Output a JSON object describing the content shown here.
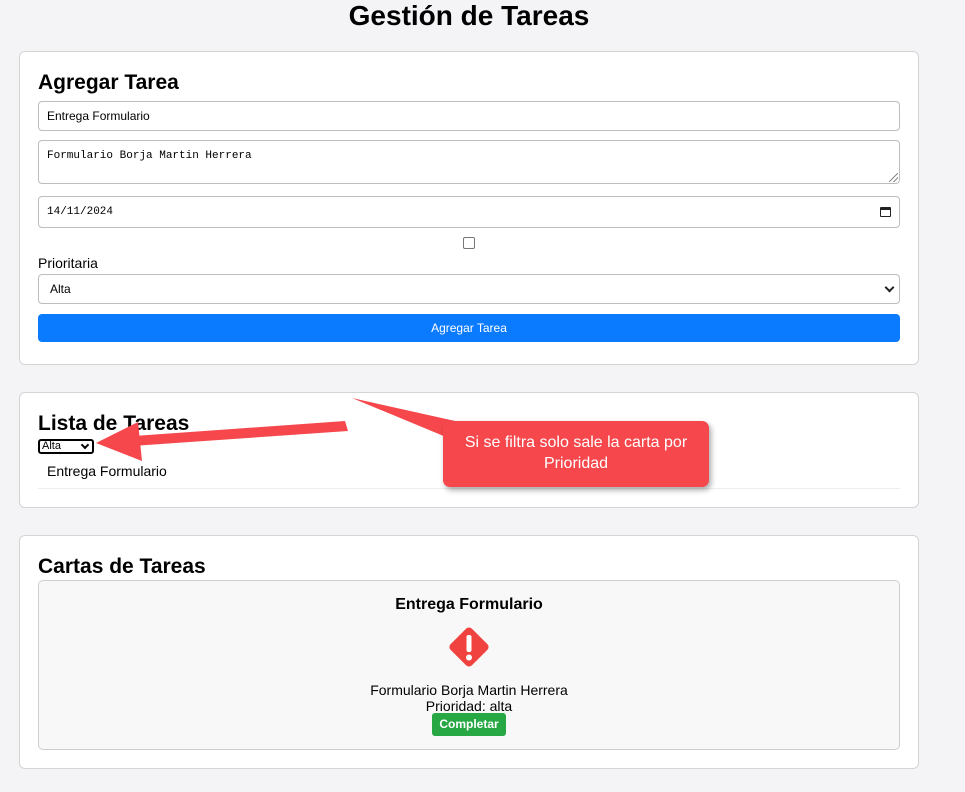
{
  "page": {
    "title": "Gestión de Tareas"
  },
  "add_form": {
    "heading": "Agregar Tarea",
    "title_value": "Entrega Formulario",
    "description_value": "Formulario Borja Martin Herrera",
    "date_value": "14/11/2024",
    "checkbox_checked": false,
    "priority_label": "Prioritaria",
    "priority_value": "Alta",
    "submit_label": "Agregar Tarea"
  },
  "task_list": {
    "heading": "Lista de Tareas",
    "filter_value": "Alta",
    "items": [
      {
        "label": "Entrega Formulario"
      }
    ]
  },
  "cards": {
    "heading": "Cartas de Tareas",
    "items": [
      {
        "title": "Entrega Formulario",
        "icon": "warning-diamond-icon",
        "description": "Formulario Borja Martin Herrera",
        "priority": "Prioridad: alta",
        "complete_label": "Completar"
      }
    ]
  },
  "annotation": {
    "text": "Si se filtra solo sale la carta por Prioridad"
  },
  "colors": {
    "primary": "#0a7bff",
    "success": "#28a745",
    "warning_icon": "#f0433f",
    "annotation": "#f5474c"
  }
}
